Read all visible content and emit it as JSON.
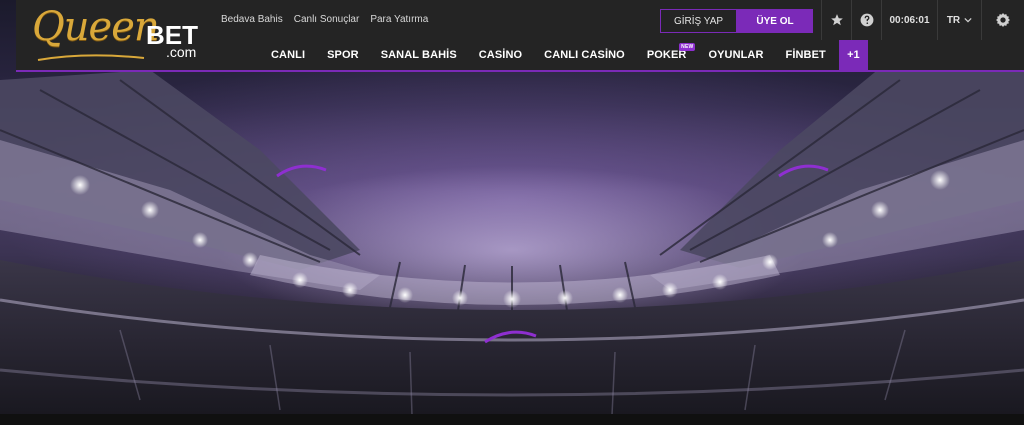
{
  "brand": {
    "logo_script": "Queen",
    "logo_bold": "BET",
    "logo_suffix": ".com"
  },
  "top_links": [
    {
      "label": "Bedava Bahis"
    },
    {
      "label": "Canlı Sonuçlar"
    },
    {
      "label": "Para Yatırma"
    }
  ],
  "auth": {
    "login_label": "GİRİŞ YAP",
    "register_label": "ÜYE OL"
  },
  "utilities": {
    "favorites_icon": "star-icon",
    "help_icon": "help-circle-icon",
    "clock": "00:06:01",
    "language": "TR",
    "settings_icon": "gear-icon"
  },
  "main_nav": [
    {
      "label": "CANLI"
    },
    {
      "label": "SPOR"
    },
    {
      "label": "SANAL BAHİS"
    },
    {
      "label": "CASİNO"
    },
    {
      "label": "CANLI CASİNO"
    },
    {
      "label": "POKER",
      "badge": "NEW"
    },
    {
      "label": "OYUNLAR"
    },
    {
      "label": "FİNBET"
    }
  ],
  "nav_more": "+1",
  "colors": {
    "accent": "#7b2ab8",
    "header_bg": "#242424",
    "logo_gold": "#d9a83a"
  }
}
